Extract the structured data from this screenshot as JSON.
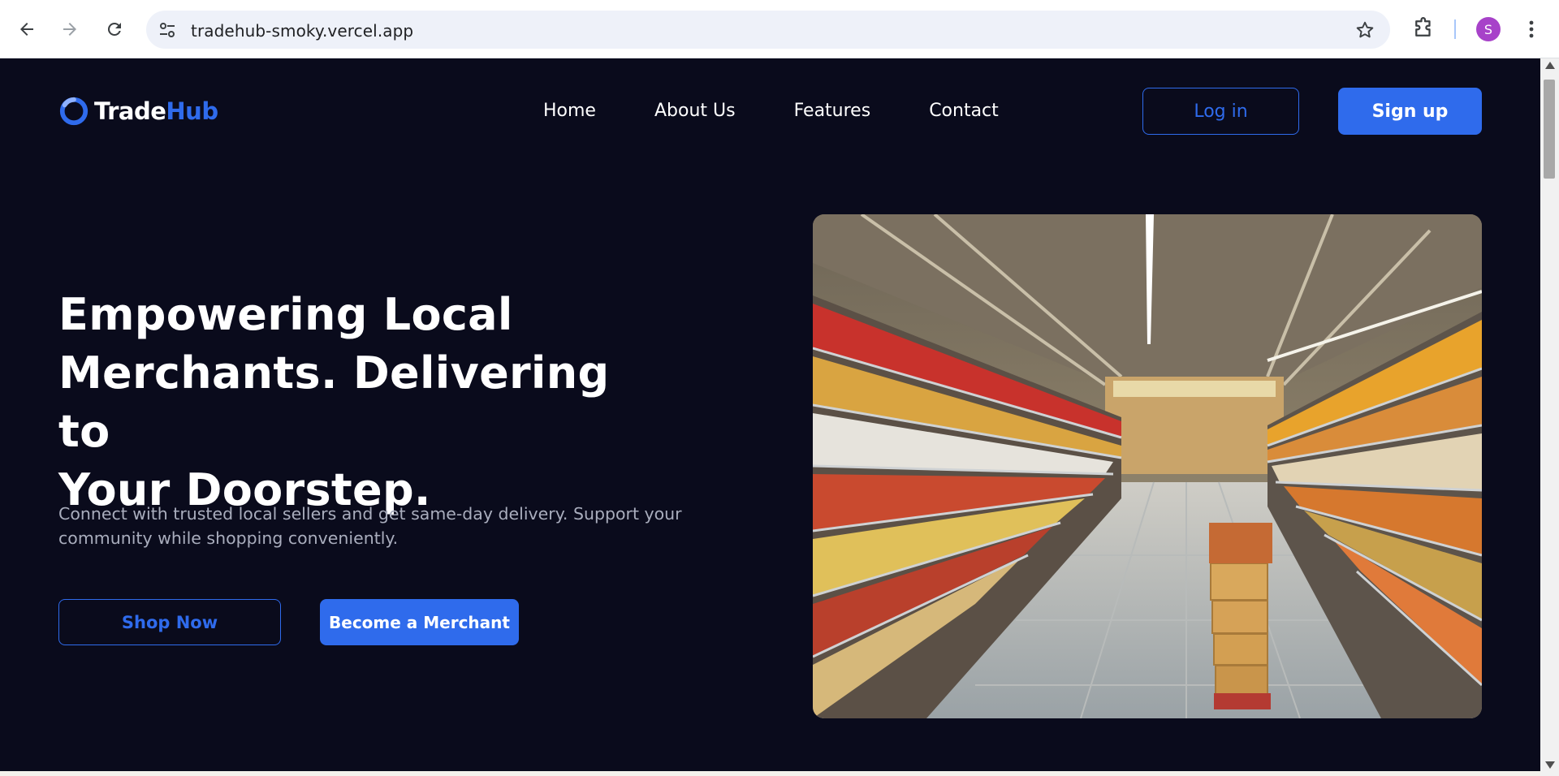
{
  "browser": {
    "url": "tradehub-smoky.vercel.app",
    "profile_initial": "S"
  },
  "site": {
    "logo_part1": "Trade",
    "logo_part2": "Hub",
    "nav": [
      "Home",
      "About Us",
      "Features",
      "Contact"
    ],
    "login_label": "Log in",
    "signup_label": "Sign up"
  },
  "hero": {
    "title_lines": [
      "Empowering Local",
      "Merchants. Delivering to",
      "Your Doorstep."
    ],
    "subtitle": "Connect with trusted local sellers and get same-day delivery. Support your community while shopping conveniently.",
    "shop_label": "Shop Now",
    "merchant_label": "Become a Merchant"
  },
  "colors": {
    "page_bg": "#0a0b1c",
    "accent": "#2f6bec",
    "text": "#ffffff",
    "muted": "#a9adbd"
  }
}
